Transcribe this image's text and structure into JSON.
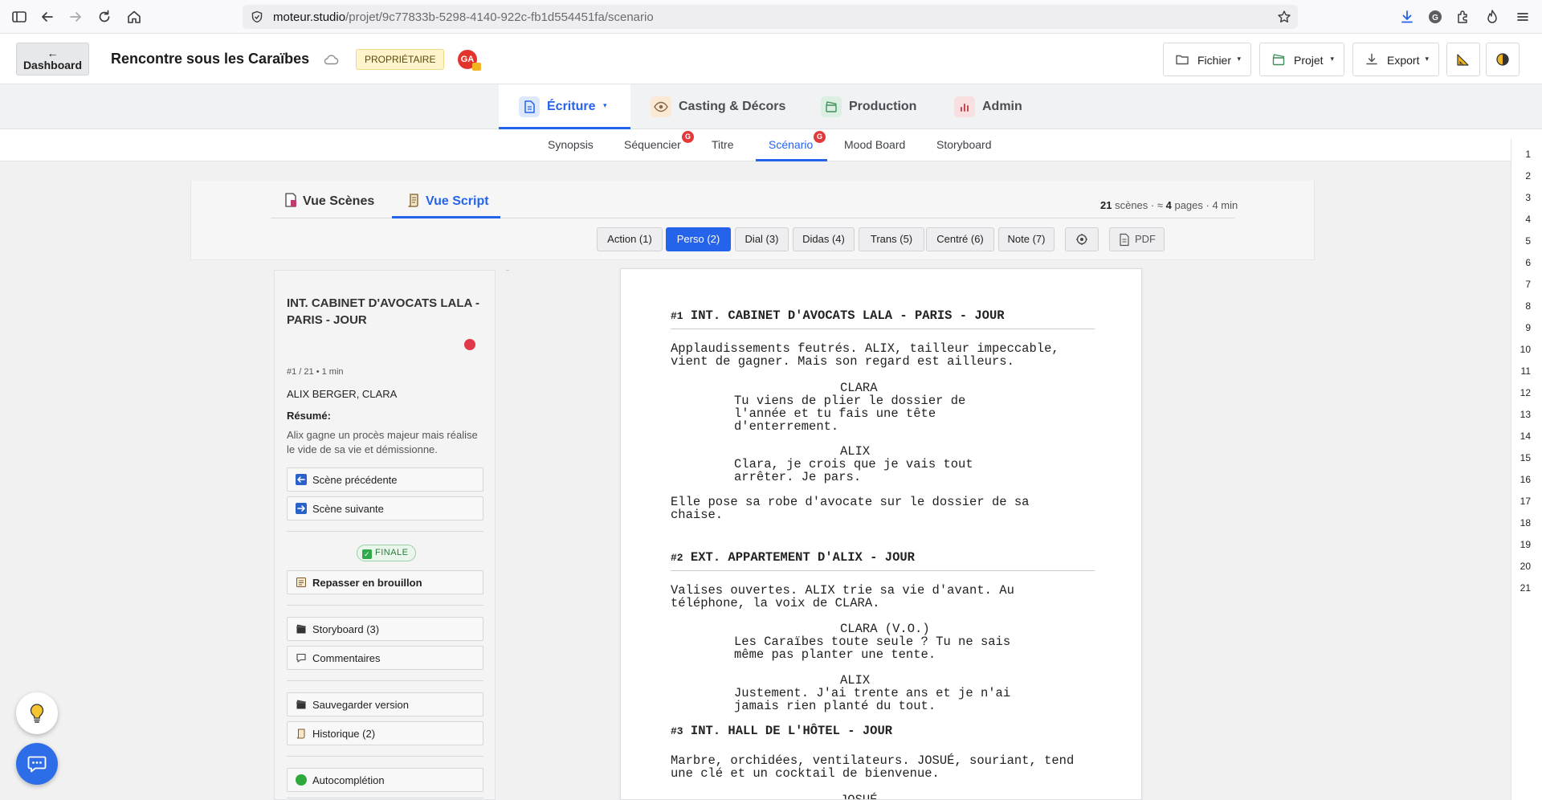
{
  "browser": {
    "url_host": "moteur.studio",
    "url_path": "/projet/9c77833b-5298-4140-922c-fb1d554451fa/scenario"
  },
  "header": {
    "dashboard_arrow": "←",
    "dashboard_label": "Dashboard",
    "project_title": "Rencontre sous les Caraïbes",
    "role_badge": "PROPRIÉTAIRE",
    "avatar_initials": "GA",
    "fichier": "Fichier",
    "projet": "Projet",
    "export": "Export",
    "caret": "▾"
  },
  "main_tabs": [
    {
      "label": "Écriture",
      "caret": "▾"
    },
    {
      "label": "Casting & Décors"
    },
    {
      "label": "Production"
    },
    {
      "label": "Admin"
    }
  ],
  "sub_tabs": [
    "Synopsis",
    "Séquencier",
    "Titre",
    "Scénario",
    "Mood Board",
    "Storyboard"
  ],
  "notif_badge": "G",
  "view_tabs": {
    "scenes": "Vue Scènes",
    "script": "Vue Script"
  },
  "stats": {
    "scenes": "21",
    "scenes_label": "scènes · ≈",
    "pages": "4",
    "pages_label": "pages · 4 min"
  },
  "filters": [
    "Action (1)",
    "Perso (2)",
    "Dial (3)",
    "Didas (4)",
    "Trans (5)",
    "Centré (6)",
    "Note (7)",
    "PDF"
  ],
  "scene_panel": {
    "title": "INT. CABINET D'AVOCATS LALA - PARIS - JOUR",
    "meta": "#1 / 21 • 1 min",
    "characters": "ALIX BERGER, CLARA",
    "summary_label": "Résumé:",
    "summary": "Alix gagne un procès majeur mais réalise le vide de sa vie et démissionne.",
    "prev": "Scène précédente",
    "next": "Scène suivante",
    "status": "FINALE",
    "draft": "Repasser en brouillon",
    "storyboard": "Storyboard (3)",
    "comments": "Commentaires",
    "save_version": "Sauvegarder version",
    "history": "Historique (2)",
    "autocomplete": "Autocomplétion"
  },
  "script": {
    "s1_num": "#1",
    "s1_heading": "INT. CABINET D'AVOCATS LALA - PARIS - JOUR",
    "s1_action1": "Applaudissements feutrés. ALIX, tailleur impeccable,\nvient de gagner. Mais son regard est ailleurs.",
    "s1_char1": "CLARA",
    "s1_dial1": "Tu viens de plier le dossier de\nl'année et tu fais une tête\nd'enterrement.",
    "s1_char2": "ALIX",
    "s1_dial2": "Clara, je crois que je vais tout\narrêter. Je pars.",
    "s1_action2": "Elle pose sa robe d'avocate sur le dossier de sa\nchaise.",
    "s2_num": "#2",
    "s2_heading": "EXT. APPARTEMENT D'ALIX - JOUR",
    "s2_action1": "Valises ouvertes. ALIX trie sa vie d'avant. Au\ntéléphone, la voix de CLARA.",
    "s2_char1": "CLARA (V.O.)",
    "s2_dial1": "Les Caraïbes toute seule ? Tu ne sais\nmême pas planter une tente.",
    "s2_char2": "ALIX",
    "s2_dial2": "Justement. J'ai trente ans et je n'ai\njamais rien planté du tout.",
    "s3_num": "#3",
    "s3_heading": "INT. HALL DE L'HÔTEL - JOUR",
    "s3_action1": "Marbre, orchidées, ventilateurs. JOSUÉ, souriant, tend\nune clé et un cocktail de bienvenue.",
    "s3_char1": "JOSUÉ"
  },
  "line_numbers": [
    "1",
    "2",
    "3",
    "4",
    "5",
    "6",
    "7",
    "8",
    "9",
    "10",
    "11",
    "12",
    "13",
    "14",
    "15",
    "16",
    "17",
    "18",
    "19",
    "20",
    "21"
  ],
  "colors": {
    "accent": "#2563eb",
    "finale": "#2eaa4a",
    "notif": "#e03a3a",
    "chat": "#2d6ee8"
  }
}
